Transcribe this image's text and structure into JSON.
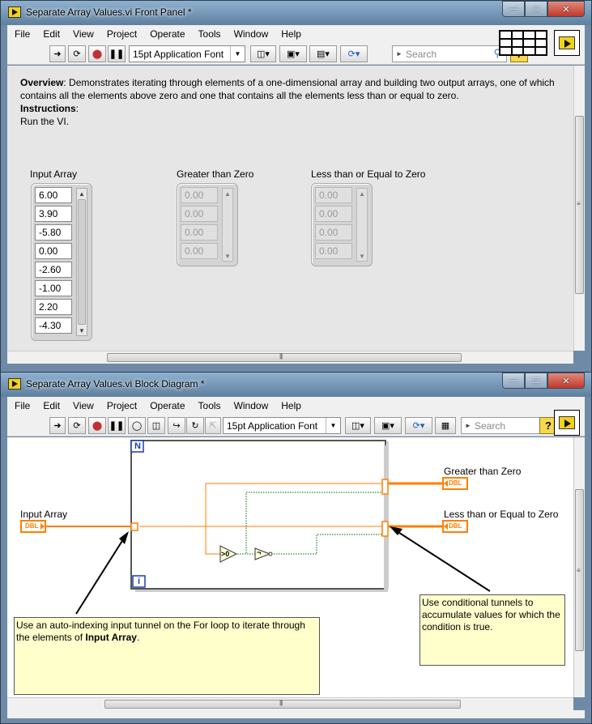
{
  "front_panel": {
    "title": "Separate Array Values.vi Front Panel *",
    "menu": [
      "File",
      "Edit",
      "View",
      "Project",
      "Operate",
      "Tools",
      "Window",
      "Help"
    ],
    "font_select": "15pt Application Font",
    "search_placeholder": "Search",
    "help_label": "?",
    "overview": {
      "heading": "Overview",
      "text": ": Demonstrates iterating through elements of a one-dimensional array and building two output arrays, one of which contains all the elements above zero and one that contains all the elements less than or equal to zero.",
      "instructions_heading": "Instructions",
      "instructions_colon": ":",
      "instructions_text": "Run the VI."
    },
    "input_array": {
      "label": "Input Array",
      "values": [
        "6.00",
        "3.90",
        "-5.80",
        "0.00",
        "-2.60",
        "-1.00",
        "2.20",
        "-4.30"
      ]
    },
    "greater_array": {
      "label": "Greater than Zero",
      "values": [
        "0.00",
        "0.00",
        "0.00",
        "0.00"
      ]
    },
    "lessequal_array": {
      "label": "Less than or Equal to Zero",
      "values": [
        "0.00",
        "0.00",
        "0.00",
        "0.00"
      ]
    }
  },
  "block_diagram": {
    "title": "Separate Array Values.vi Block Diagram *",
    "menu": [
      "File",
      "Edit",
      "View",
      "Project",
      "Operate",
      "Tools",
      "Window",
      "Help"
    ],
    "font_select": "15pt Application Font",
    "search_placeholder": "Search",
    "help_label": "?",
    "loop_count_label": "N",
    "loop_iter_label": "i",
    "input_label": "Input Array",
    "greater_label": "Greater than Zero",
    "lessequal_label": "Less than or Equal to Zero",
    "terminal_type": "DBL",
    "gt_zero_func": ">0",
    "not_func": "¬",
    "comment_left": {
      "line1": "Use an auto-indexing input tunnel on the For loop to iterate through",
      "line2a": "the elements of ",
      "line2b": "Input Array",
      "line2c": "."
    },
    "comment_right": "Use conditional tunnels to accumulate values for which the condition is true."
  },
  "colors": {
    "wire_dbl": "#ff7f00",
    "wire_bool": "#006600",
    "loop_label": "#1f3cb0",
    "comment_bg": "#ffffcc"
  }
}
